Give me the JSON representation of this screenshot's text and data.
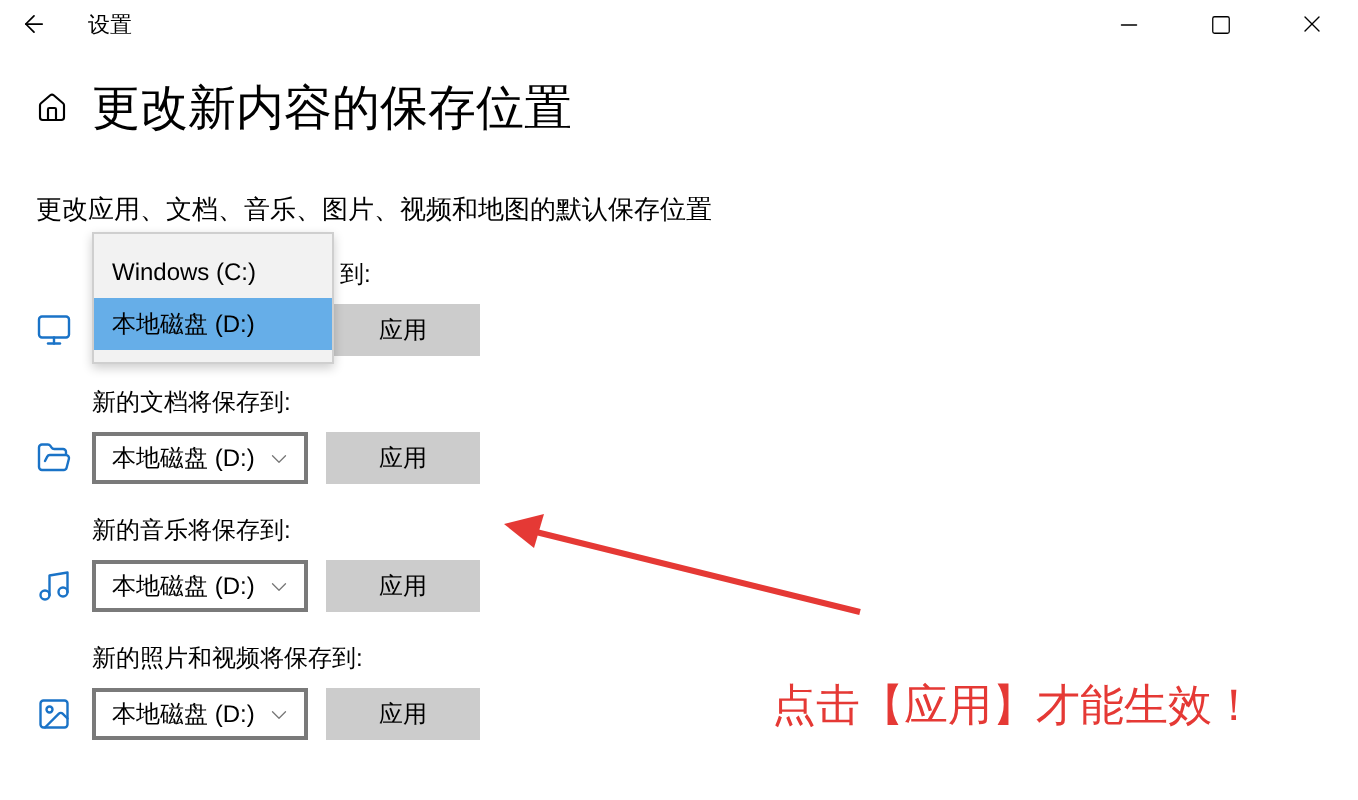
{
  "window": {
    "title": "设置"
  },
  "heading": "更改新内容的保存位置",
  "description": "更改应用、文档、音乐、图片、视频和地图的默认保存位置",
  "sections": [
    {
      "kind": "apps",
      "label": "到:",
      "button": "应用"
    },
    {
      "kind": "documents",
      "label": "新的文档将保存到:",
      "value": "本地磁盘 (D:)",
      "button": "应用"
    },
    {
      "kind": "music",
      "label": "新的音乐将保存到:",
      "value": "本地磁盘 (D:)",
      "button": "应用"
    },
    {
      "kind": "photos",
      "label": "新的照片和视频将保存到:",
      "value": "本地磁盘 (D:)",
      "button": "应用"
    }
  ],
  "dropdown": {
    "options": [
      {
        "label": "Windows (C:)",
        "selected": false
      },
      {
        "label": "本地磁盘 (D:)",
        "selected": true
      }
    ]
  },
  "annotation": {
    "text": "点击【应用】才能生效！"
  }
}
